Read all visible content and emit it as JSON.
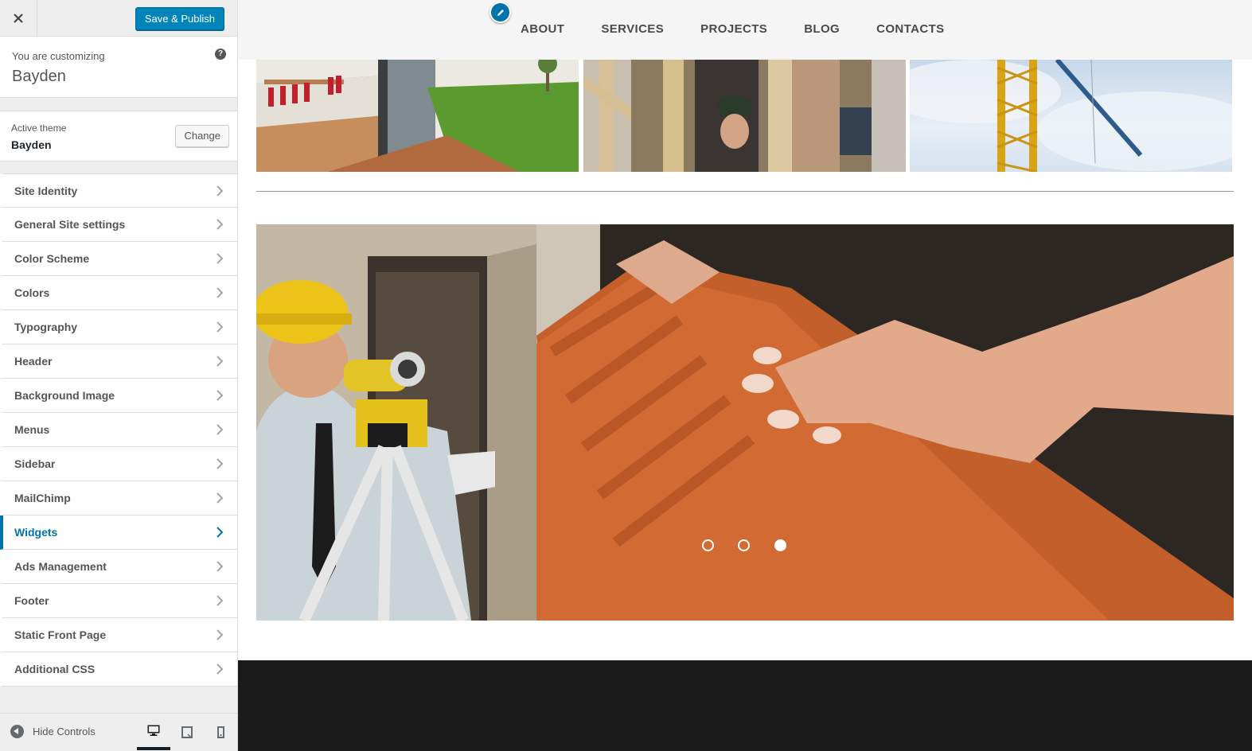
{
  "customizer": {
    "close_icon": "close-icon",
    "publish_label": "Save & Publish",
    "info": {
      "customizing_label": "You are customizing",
      "site_name": "Bayden",
      "help_icon": "help-icon"
    },
    "theme": {
      "active_label": "Active theme",
      "name": "Bayden",
      "change_label": "Change"
    },
    "sections": [
      {
        "label": "Site Identity"
      },
      {
        "label": "General Site settings"
      },
      {
        "label": "Color Scheme"
      },
      {
        "label": "Colors"
      },
      {
        "label": "Typography"
      },
      {
        "label": "Header"
      },
      {
        "label": "Background Image"
      },
      {
        "label": "Menus"
      },
      {
        "label": "Sidebar"
      },
      {
        "label": "MailChimp"
      },
      {
        "label": "Widgets",
        "active": true
      },
      {
        "label": "Ads Management"
      },
      {
        "label": "Footer"
      },
      {
        "label": "Static Front Page"
      },
      {
        "label": "Additional CSS"
      }
    ],
    "footer": {
      "hide_label": "Hide Controls",
      "devices": [
        "desktop-icon",
        "tablet-icon",
        "mobile-icon"
      ],
      "active_device": "desktop"
    },
    "accent_color": "#0073aa",
    "publish_color": "#0085ba"
  },
  "preview": {
    "nav": {
      "edit_icon": "pencil-icon",
      "items": [
        "ABOUT",
        "SERVICES",
        "PROJECTS",
        "BLOG",
        "CONTACTS"
      ]
    },
    "gallery": [
      "interior-photo",
      "carpenter-drill-photo",
      "crane-sky-photo"
    ],
    "slider": {
      "images": [
        "engineer-surveyor-photo",
        "roof-tile-hands-photo"
      ],
      "dot_count": 3,
      "active_dot": 3
    },
    "footer_color": "#1a1a1a"
  }
}
